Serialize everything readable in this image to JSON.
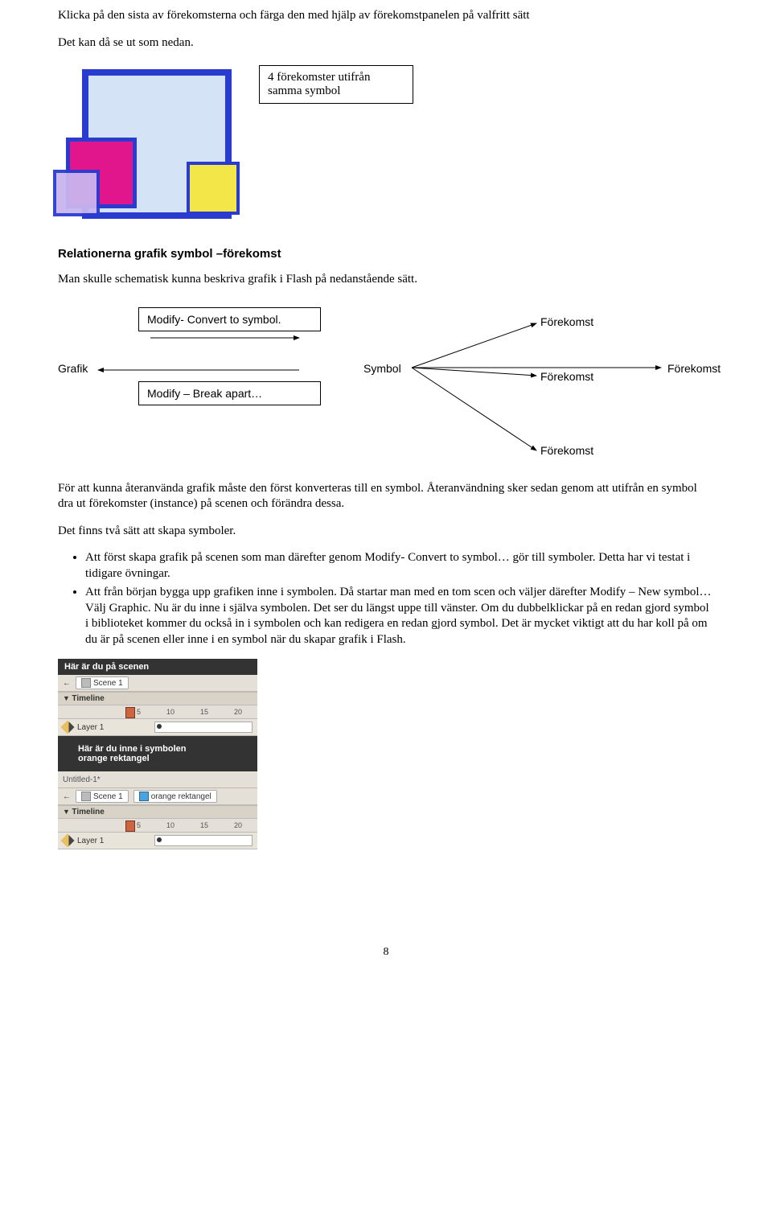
{
  "intro": {
    "p1": "Klicka på den sista av förekomsterna och färga den med hjälp av förekomstpanelen på valfritt sätt",
    "p2": "Det kan då se ut som nedan."
  },
  "caption1": "4 förekomster utifrån samma symbol",
  "heading1": "Relationerna grafik symbol –förekomst",
  "p3": "Man skulle schematisk kunna beskriva grafik i Flash på nedanstående sätt.",
  "diagram": {
    "convert": "Modify- Convert to symbol.",
    "break": "Modify – Break apart…",
    "grafik": "Grafik",
    "symbol": "Symbol",
    "forekomst": "Förekomst"
  },
  "p4": "För att kunna återanvända grafik måste den först konverteras till en symbol. Återanvändning sker sedan genom att utifrån en symbol dra ut förekomster (instance) på scenen och förändra dessa.",
  "p5": "Det finns två sätt att skapa symboler.",
  "bullets": {
    "b1": "Att först skapa grafik på scenen som man därefter genom Modify- Convert to symbol… gör till symboler. Detta har vi testat i tidigare övningar.",
    "b2": "Att från början bygga upp grafiken inne i symbolen. Då startar man med en tom scen och väljer därefter Modify – New symbol… Välj Graphic. Nu är du inne i själva symbolen. Det ser du längst uppe till vänster. Om du dubbelklickar på en redan gjord symbol i biblioteket kommer du också in i symbolen och kan redigera en redan gjord symbol. Det är mycket viktigt att du har koll på om du är på scenen eller inne i en symbol när du skapar grafik i Flash."
  },
  "shots": {
    "t1": "Här är du på scenen",
    "scene": "Scene 1",
    "timeline": "Timeline",
    "layer": "Layer 1",
    "ruler": {
      "n5": "5",
      "n10": "10",
      "n15": "15",
      "n20": "20"
    },
    "t2a": "Här är du inne i symbolen",
    "t2b": "orange rektangel",
    "untitled": "Untitled-1*",
    "graphic": "orange rektangel"
  },
  "pagenum": "8"
}
